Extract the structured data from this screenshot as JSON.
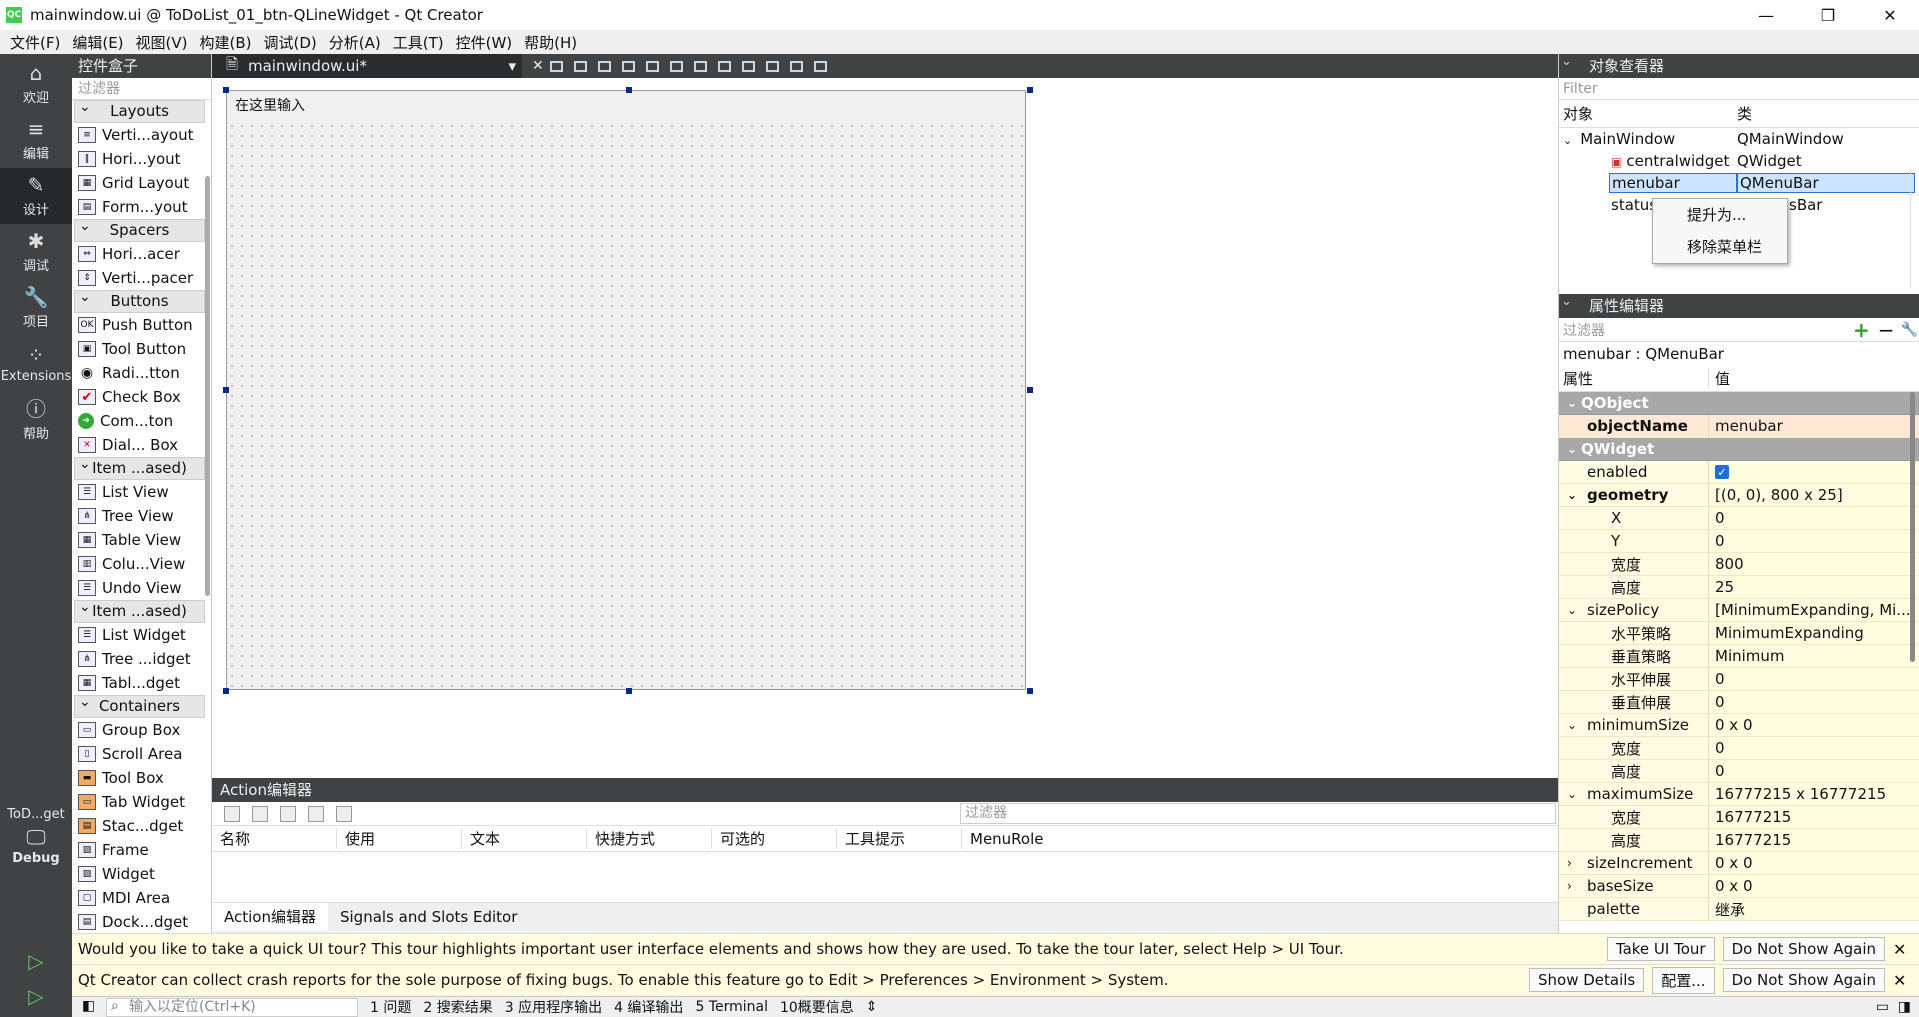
{
  "window": {
    "title": "mainwindow.ui @ ToDoList_01_btn-QLineWidget - Qt Creator",
    "app_icon": "QC"
  },
  "menubar": [
    "文件(F)",
    "编辑(E)",
    "视图(V)",
    "构建(B)",
    "调试(D)",
    "分析(A)",
    "工具(T)",
    "控件(W)",
    "帮助(H)"
  ],
  "modes": [
    "欢迎",
    "编辑",
    "设计",
    "调试",
    "项目",
    "Extensions",
    "帮助"
  ],
  "kit": {
    "project": "ToD...get",
    "config": "Debug"
  },
  "widgetbox": {
    "title": "控件盒子",
    "filter": "过滤器",
    "categories": [
      {
        "name": "Layouts",
        "items": [
          "Verti...ayout",
          "Hori...yout",
          "Grid Layout",
          "Form...yout"
        ]
      },
      {
        "name": "Spacers",
        "items": [
          "Hori...acer",
          "Verti...pacer"
        ]
      },
      {
        "name": "Buttons",
        "items": [
          "Push Button",
          "Tool Button",
          "Radi...tton",
          "Check Box",
          "Com...ton",
          "Dial... Box"
        ]
      },
      {
        "name": "Item ...ased)",
        "items": [
          "List View",
          "Tree View",
          "Table View",
          "Colu...View",
          "Undo View"
        ]
      },
      {
        "name": "Item ...ased)",
        "items": [
          "List Widget",
          "Tree ...idget",
          "Tabl...dget"
        ]
      },
      {
        "name": "Containers",
        "items": [
          "Group Box",
          "Scroll Area",
          "Tool Box",
          "Tab Widget",
          "Stac...dget",
          "Frame",
          "Widget",
          "MDI Area",
          "Dock...dget"
        ]
      }
    ]
  },
  "editor": {
    "file_tab": "mainwindow.ui*",
    "menu_placeholder": "在这里输入"
  },
  "action_editor": {
    "title": "Action编辑器",
    "filter": "过滤器",
    "columns": [
      "名称",
      "使用",
      "文本",
      "快捷方式",
      "可选的",
      "工具提示",
      "MenuRole"
    ],
    "tabs": [
      "Action编辑器",
      "Signals and Slots Editor"
    ]
  },
  "object_inspector": {
    "title": "对象查看器",
    "filter": "Filter",
    "headers": [
      "对象",
      "类"
    ],
    "rows": [
      {
        "name": "MainWindow",
        "class": "QMainWindow"
      },
      {
        "name": "centralwidget",
        "class": "QWidget"
      },
      {
        "name": "menubar",
        "class": "QMenuBar"
      },
      {
        "name": "status",
        "class": "sBar"
      }
    ]
  },
  "context_menu": [
    "提升为...",
    "移除菜单栏"
  ],
  "property_editor": {
    "title": "属性编辑器",
    "filter": "过滤器",
    "object_class": "menubar : QMenuBar",
    "headers": [
      "属性",
      "值"
    ],
    "rows": [
      {
        "k": "QObject",
        "v": ""
      },
      {
        "k": "objectName",
        "v": "menubar"
      },
      {
        "k": "QWidget",
        "v": ""
      },
      {
        "k": "enabled",
        "v": ""
      },
      {
        "k": "geometry",
        "v": "[(0, 0), 800 x 25]"
      },
      {
        "k": "X",
        "v": "0"
      },
      {
        "k": "Y",
        "v": "0"
      },
      {
        "k": "宽度",
        "v": "800"
      },
      {
        "k": "高度",
        "v": "25"
      },
      {
        "k": "sizePolicy",
        "v": "[MinimumExpanding, Mi..."
      },
      {
        "k": "水平策略",
        "v": "MinimumExpanding"
      },
      {
        "k": "垂直策略",
        "v": "Minimum"
      },
      {
        "k": "水平伸展",
        "v": "0"
      },
      {
        "k": "垂直伸展",
        "v": "0"
      },
      {
        "k": "minimumSize",
        "v": "0 x 0"
      },
      {
        "k": "宽度",
        "v": "0"
      },
      {
        "k": "高度",
        "v": "0"
      },
      {
        "k": "maximumSize",
        "v": "16777215 x 16777215"
      },
      {
        "k": "宽度",
        "v": "16777215"
      },
      {
        "k": "高度",
        "v": "16777215"
      },
      {
        "k": "sizeIncrement",
        "v": "0 x 0"
      },
      {
        "k": "baseSize",
        "v": "0 x 0"
      },
      {
        "k": "palette",
        "v": "继承"
      }
    ]
  },
  "infobars": [
    {
      "message": "Would you like to take a quick UI tour? This tour highlights important user interface elements and shows how they are used. To take the tour later, select Help > UI Tour.",
      "buttons": [
        "Take UI Tour",
        "Do Not Show Again"
      ]
    },
    {
      "message": "Qt Creator can collect crash reports for the sole purpose of fixing bugs. To enable this feature go to Edit > Preferences > Environment > System.",
      "buttons": [
        "Show Details",
        "配置...",
        "Do Not Show Again"
      ]
    }
  ],
  "statusbar": {
    "locator_placeholder": "输入以定位(Ctrl+K)",
    "outputs": [
      "1 问题",
      "2 搜索结果",
      "3 应用程序输出",
      "4 编译输出",
      "5 Terminal",
      "10概要信息"
    ]
  }
}
